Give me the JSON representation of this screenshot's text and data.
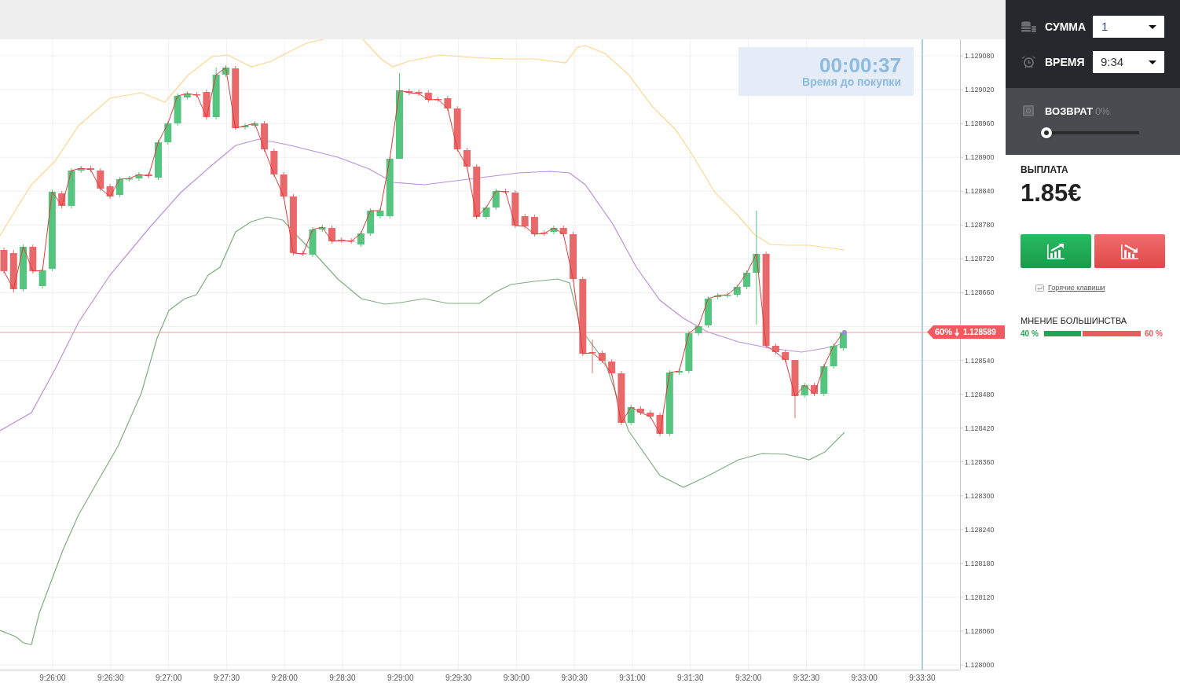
{
  "chart": {
    "timer": {
      "time": "00:00:37",
      "label": "Время до покупки"
    },
    "price_tag": {
      "percent": "60%",
      "price": "1.128589"
    },
    "price_axis": {
      "labels_above_tag": [
        "1.129080",
        "1.129020",
        "1.128960",
        "1.128900",
        "1.128840",
        "1.128780",
        "1.128720",
        "1.128660"
      ],
      "labels_below_tag": [
        "1.128540",
        "1.128480",
        "1.128420",
        "1.128360",
        "1.128300",
        "1.128240",
        "1.128180",
        "1.128120",
        "1.128060",
        "1.128000"
      ]
    },
    "time_axis": {
      "labels": [
        "9:26:00",
        "9:26:30",
        "9:27:00",
        "9:27:30",
        "9:28:00",
        "9:28:30",
        "9:29:00",
        "9:29:30",
        "9:30:00",
        "9:30:30",
        "9:31:00",
        "9:31:30",
        "9:32:00",
        "9:32:30",
        "9:33:00",
        "9:33:30"
      ]
    }
  },
  "trade_panel": {
    "amount": {
      "label": "СУММА",
      "value": "1"
    },
    "time": {
      "label": "ВРЕМЯ",
      "value": "9:34"
    },
    "refund": {
      "label": "ВОЗВРАТ",
      "value": "0%",
      "level": 0
    },
    "payout": {
      "label": "ВЫПЛАТА",
      "value": "1.85€"
    },
    "hotkeys_link": "Горячие клавиши",
    "majority": {
      "title": "МНЕНИЕ БОЛЬШИНСТВА",
      "up": "40 %",
      "down": "60 %",
      "level": 0.4
    }
  }
}
